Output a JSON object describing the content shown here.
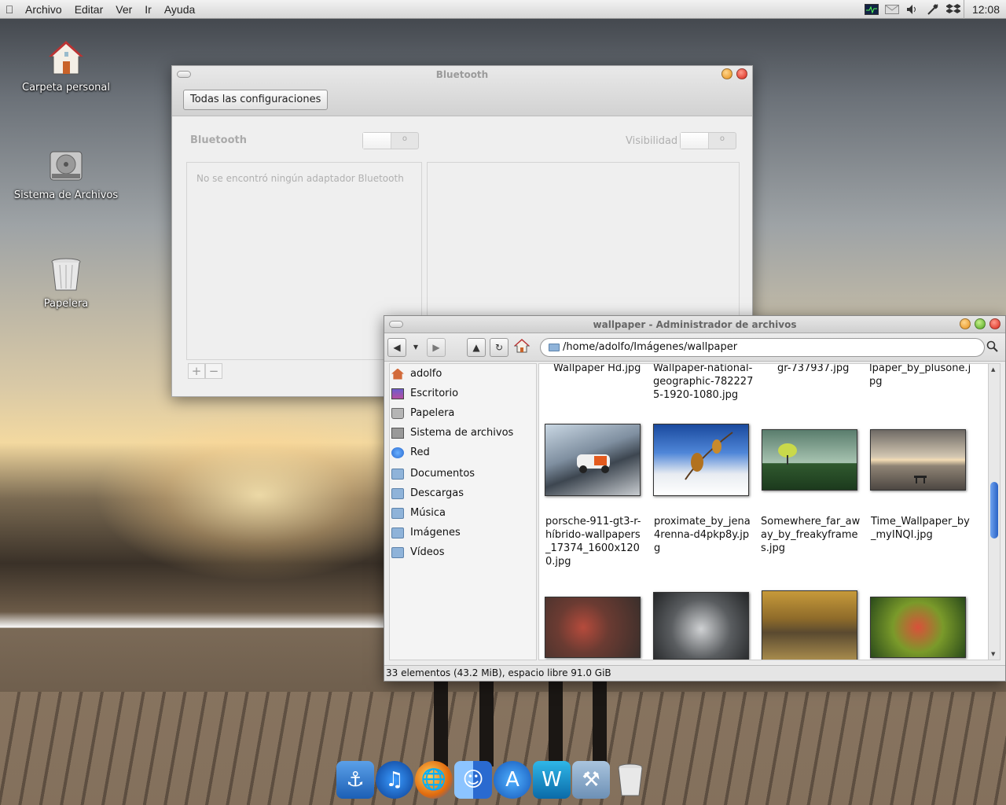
{
  "topbar": {
    "menus": [
      "Archivo",
      "Editar",
      "Ver",
      "Ir",
      "Ayuda"
    ],
    "clock": "12:08"
  },
  "desktop": {
    "icons": [
      {
        "label": "Carpeta personal",
        "icon": "home-folder-icon"
      },
      {
        "label": "Sistema de Archivos",
        "icon": "hard-drive-icon"
      },
      {
        "label": "Papelera",
        "icon": "trash-icon"
      }
    ]
  },
  "bluetooth": {
    "title": "Bluetooth",
    "all_settings": "Todas las configuraciones",
    "label": "Bluetooth",
    "visibility": "Visibilidad",
    "empty_message": "No se encontró ningún adaptador Bluetooth",
    "add": "+",
    "remove": "−"
  },
  "filemanager": {
    "title": "wallpaper - Administrador de archivos",
    "path": "/home/adolfo/Imágenes/wallpaper",
    "sidebar": [
      {
        "label": "adolfo",
        "icon": "home-icon"
      },
      {
        "label": "Escritorio",
        "icon": "desktop-icon"
      },
      {
        "label": "Papelera",
        "icon": "trash-icon"
      },
      {
        "label": "Sistema de archivos",
        "icon": "disk-icon"
      },
      {
        "label": "Red",
        "icon": "network-icon"
      },
      {
        "label": "Documentos",
        "icon": "folder-icon"
      },
      {
        "label": "Descargas",
        "icon": "folder-icon"
      },
      {
        "label": "Música",
        "icon": "folder-icon"
      },
      {
        "label": "Imágenes",
        "icon": "folder-icon"
      },
      {
        "label": "Vídeos",
        "icon": "folder-icon"
      }
    ],
    "top_labels": [
      "Wallpaper Hd.jpg",
      "Wallpaper-national-geographic-7822275-1920-1080.jpg",
      "gr-737937.jpg",
      "lpaper_by_plusone.jpg"
    ],
    "files_row1": [
      "porsche-911-gt3-r-híbrido-wallpapers_17374_1600x1200.jpg",
      "proximate_by_jena4renna-d4pkp8y.jpg",
      "Somewhere_far_away_by_freakyframes.jpg",
      "Time_Wallpaper_by_myINQI.jpg"
    ],
    "status": "33 elementos (43.2 MiB), espacio libre 91.0 GiB"
  },
  "dock": {
    "items": [
      "anchor-icon",
      "music-icon",
      "browser-icon",
      "finder-icon",
      "app-store-icon",
      "word-icon",
      "tools-folder-icon",
      "trash-icon"
    ]
  }
}
